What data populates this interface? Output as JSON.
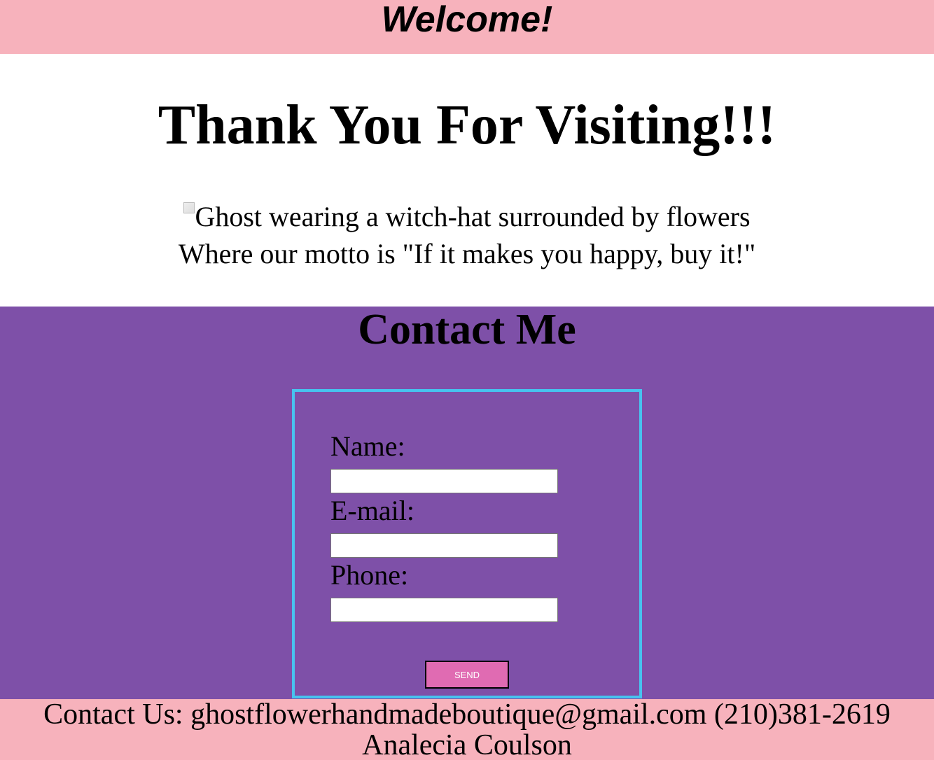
{
  "header": {
    "title": "Welcome!"
  },
  "hero": {
    "heading": "Thank You For Visiting!!!",
    "image_alt": "Ghost wearing a witch-hat surrounded by flowers",
    "motto": "Where our motto is \"If it makes you happy, buy it!\""
  },
  "contact": {
    "heading": "Contact Me",
    "fields": [
      {
        "label": "Name:",
        "value": ""
      },
      {
        "label": "E-mail:",
        "value": ""
      },
      {
        "label": "Phone:",
        "value": ""
      }
    ],
    "send_label": "SEND"
  },
  "footer": {
    "contact_line": "Contact Us: ghostflowerhandmadeboutique@gmail.com (210)381-2619",
    "author": "Analecia Coulson"
  },
  "colors": {
    "header_bg": "#f7b2bc",
    "contact_bg": "#7e50a8",
    "form_border": "#47c3ef",
    "send_button": "#e06bb2"
  }
}
